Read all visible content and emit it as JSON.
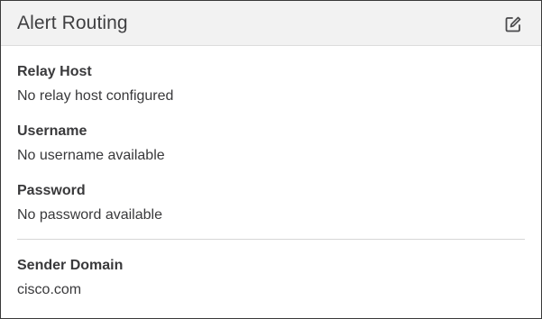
{
  "card": {
    "title": "Alert Routing",
    "edit_icon": "edit-icon"
  },
  "fields": [
    {
      "label": "Relay Host",
      "value": "No relay host configured"
    },
    {
      "label": "Username",
      "value": "No username available"
    },
    {
      "label": "Password",
      "value": "No password available"
    },
    {
      "label": "Sender Domain",
      "value": "cisco.com"
    }
  ]
}
